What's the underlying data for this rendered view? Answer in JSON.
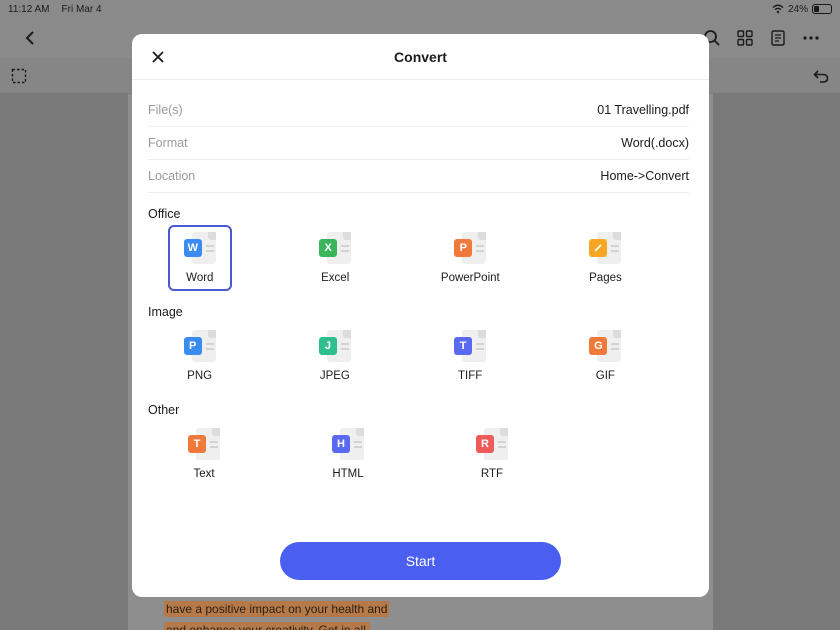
{
  "status": {
    "time": "11:12 AM",
    "date": "Fri Mar 4",
    "battery": "24%"
  },
  "document": {
    "line1": "have a positive impact on your health and",
    "line2": "and enhance your creativity. Get in all"
  },
  "modal": {
    "title": "Convert",
    "info": [
      {
        "label": "File(s)",
        "value": "01 Travelling.pdf"
      },
      {
        "label": "Format",
        "value": "Word(.docx)"
      },
      {
        "label": "Location",
        "value": "Home->Convert"
      }
    ],
    "sections": {
      "office": {
        "title": "Office",
        "items": [
          {
            "label": "Word",
            "letter": "W",
            "color": "#3b8cf0",
            "selected": true
          },
          {
            "label": "Excel",
            "letter": "X",
            "color": "#3bb55c"
          },
          {
            "label": "PowerPoint",
            "letter": "P",
            "color": "#f07a3b"
          },
          {
            "label": "Pages",
            "letter": "",
            "color": "#f5a623"
          }
        ]
      },
      "image": {
        "title": "Image",
        "items": [
          {
            "label": "PNG",
            "letter": "P",
            "color": "#3b8cf0"
          },
          {
            "label": "JPEG",
            "letter": "J",
            "color": "#2fbf8f"
          },
          {
            "label": "TIFF",
            "letter": "T",
            "color": "#5a6af0"
          },
          {
            "label": "GIF",
            "letter": "G",
            "color": "#f07a3b"
          }
        ]
      },
      "other": {
        "title": "Other",
        "items": [
          {
            "label": "Text",
            "letter": "T",
            "color": "#f07a3b"
          },
          {
            "label": "HTML",
            "letter": "H",
            "color": "#5a6af0"
          },
          {
            "label": "RTF",
            "letter": "R",
            "color": "#ef5a5a"
          }
        ]
      }
    },
    "start_label": "Start"
  },
  "colors": {
    "accent": "#4a5ef0",
    "selected_border": "#4a5ad6"
  }
}
